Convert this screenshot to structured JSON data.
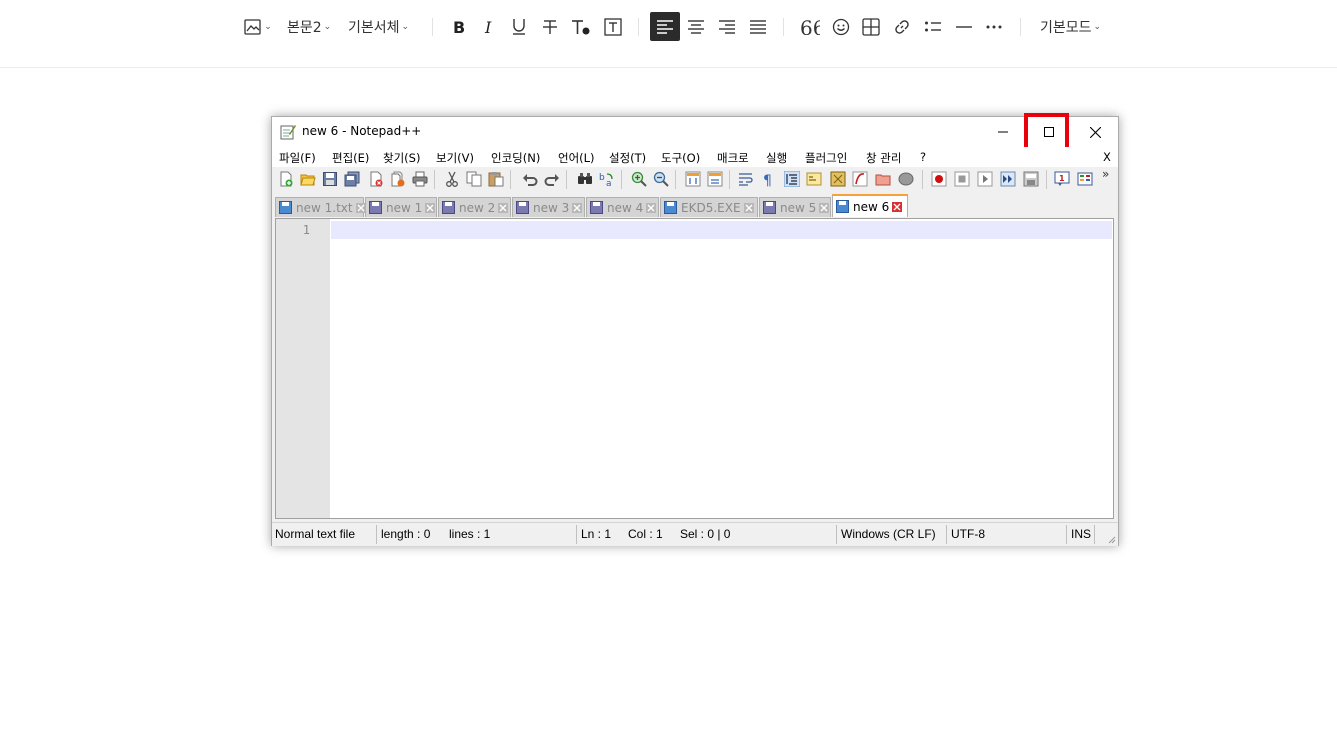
{
  "editor_toolbar": {
    "style_label": "본문2",
    "font_label": "기본서체",
    "mode_label": "기본모드"
  },
  "window": {
    "title": "new 6 - Notepad++",
    "menu_close_label": "X",
    "menus": [
      "파일(F)",
      "편집(E)",
      "찾기(S)",
      "보기(V)",
      "인코딩(N)",
      "언어(L)",
      "설정(T)",
      "도구(O)",
      "매크로",
      "실행",
      "플러그인",
      "창 관리",
      "?"
    ],
    "overflow_label": "»",
    "highlight_color": "#e8000b"
  },
  "tabs": [
    {
      "label": "new 1.txt"
    },
    {
      "label": "new 1"
    },
    {
      "label": "new 2"
    },
    {
      "label": "new 3"
    },
    {
      "label": "new 4"
    },
    {
      "label": "EKD5.EXE"
    },
    {
      "label": "new 5"
    },
    {
      "label": "new 6"
    }
  ],
  "editor": {
    "line_number": "1"
  },
  "statusbar": {
    "file_type": "Normal text file",
    "length": "length : 0",
    "lines": "lines : 1",
    "ln": "Ln : 1",
    "col": "Col : 1",
    "sel": "Sel : 0 | 0",
    "eol": "Windows (CR LF)",
    "encoding": "UTF-8",
    "mode": "INS"
  }
}
